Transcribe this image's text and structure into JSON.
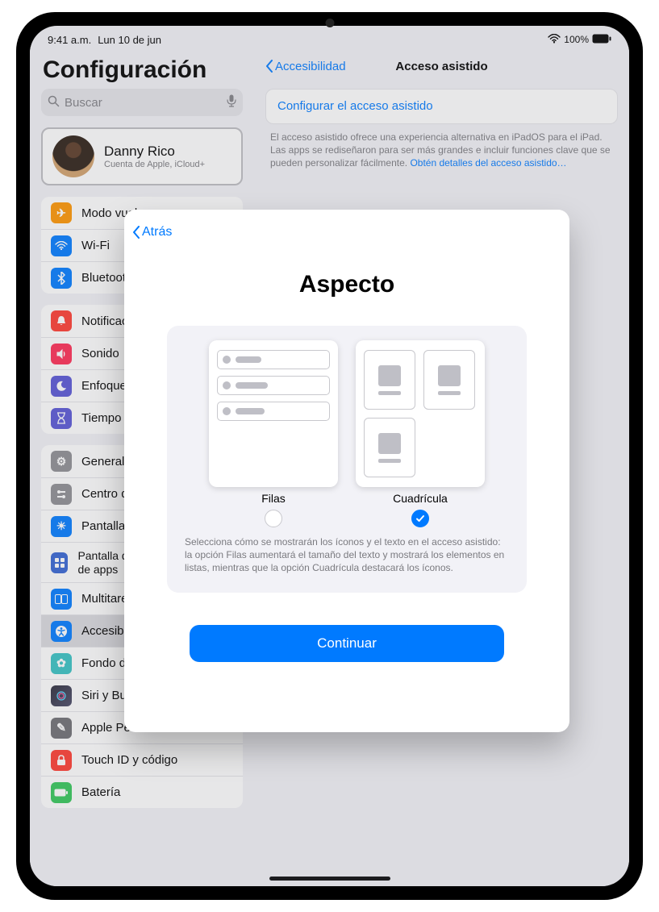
{
  "status": {
    "time": "9:41 a.m.",
    "date": "Lun 10 de jun",
    "wifi": "wifi-icon",
    "battery_pct": "100%"
  },
  "sidebar": {
    "title": "Configuración",
    "search_placeholder": "Buscar",
    "profile": {
      "name": "Danny Rico",
      "subtitle": "Cuenta de Apple, iCloud+"
    },
    "group1": [
      {
        "label": "Modo vuelo",
        "icon_color": "#ff9500",
        "glyph": "✈"
      },
      {
        "label": "Wi-Fi",
        "icon_color": "#007aff",
        "glyph": "wifi"
      },
      {
        "label": "Bluetooth",
        "icon_color": "#007aff",
        "glyph": "bt"
      }
    ],
    "group2": [
      {
        "label": "Notificaciones",
        "icon_color": "#ff3b30",
        "glyph": "bell"
      },
      {
        "label": "Sonido",
        "icon_color": "#ff3b30",
        "glyph": "speaker"
      },
      {
        "label": "Enfoque",
        "icon_color": "#5856d6",
        "glyph": "moon"
      },
      {
        "label": "Tiempo en pantalla",
        "icon_color": "#5856d6",
        "glyph": "hourglass"
      }
    ],
    "group3": [
      {
        "label": "General",
        "icon_color": "#8e8e93",
        "glyph": "gear"
      },
      {
        "label": "Centro de control",
        "icon_color": "#8e8e93",
        "glyph": "sliders"
      },
      {
        "label": "Pantalla y brillo",
        "icon_color": "#007aff",
        "glyph": "sun"
      },
      {
        "label": "Pantalla de inicio y biblioteca de apps",
        "icon_color": "#3564d4",
        "glyph": "grid"
      },
      {
        "label": "Multitarea y gestos",
        "icon_color": "#007aff",
        "glyph": "multi"
      },
      {
        "label": "Accesibilidad",
        "icon_color": "#007aff",
        "glyph": "access",
        "selected": true
      },
      {
        "label": "Fondo de pantalla",
        "icon_color": "#37c2c4",
        "glyph": "flower"
      },
      {
        "label": "Siri y Buscar",
        "icon_color": "#3a3a3c",
        "glyph": "siri"
      },
      {
        "label": "Apple Pencil",
        "icon_color": "#6e6e73",
        "glyph": "pencil"
      },
      {
        "label": "Touch ID y código",
        "icon_color": "#ff3b30",
        "glyph": "lock"
      },
      {
        "label": "Batería",
        "icon_color": "#34c759",
        "glyph": "battery"
      }
    ]
  },
  "detail": {
    "back_label": "Accesibilidad",
    "title": "Acceso asistido",
    "primary_link": "Configurar el acceso asistido",
    "footer_text": "El acceso asistido ofrece una experiencia alternativa en iPadOS para el iPad. Las apps se rediseñaron para ser más grandes e incluir funciones clave que se pueden personalizar fácilmente. ",
    "footer_link": "Obtén detalles del acceso asistido…"
  },
  "modal": {
    "back_label": "Atrás",
    "title": "Aspecto",
    "option_rows": {
      "label": "Filas",
      "selected": false
    },
    "option_grid": {
      "label": "Cuadrícula",
      "selected": true
    },
    "description": "Selecciona cómo se mostrarán los íconos y el texto en el acceso asistido: la opción Filas aumentará el tamaño del texto y mostrará los elementos en listas, mientras que la opción Cuadrícula destacará los íconos.",
    "continue_label": "Continuar"
  }
}
